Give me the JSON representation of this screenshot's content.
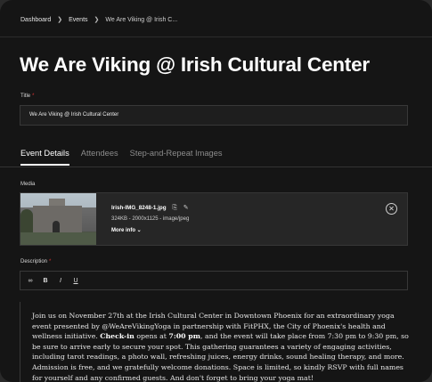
{
  "breadcrumb": {
    "items": [
      "Dashboard",
      "Events"
    ],
    "current": "We Are Viking @ Irish C..."
  },
  "page_title": "We Are Viking @ Irish Cultural Center",
  "title_field": {
    "label": "Title",
    "value": "We Are Viking @ Irish Cultural Center"
  },
  "tabs": [
    {
      "label": "Event Details",
      "active": true
    },
    {
      "label": "Attendees"
    },
    {
      "label": "Step-and-Repeat Images"
    }
  ],
  "media": {
    "label": "Media",
    "filename": "Irish-IMG_8248-1.jpg",
    "meta": "324KB - 2000x1125 - image/jpeg",
    "more_info": "More info",
    "thumbnail_alt": "Irish Cultural Center stone building"
  },
  "description": {
    "label": "Description",
    "toolbar": [
      "link-icon",
      "bold-icon",
      "italic-icon",
      "underline-icon"
    ],
    "text_1": "Join us on November 27th at the Irish Cultural Center in Downtown Phoenix for an extraordinary yoga event presented by @WeAreVikingYoga in partnership with FitPHX, the City of Phoenix's health and wellness initiative.",
    "bold_1": "Check-in",
    "text_2": "opens at",
    "bold_2": "7:00 pm",
    "text_3": ", and the event will take place from 7:30 pm to 9:30 pm, so be sure to arrive early to secure your spot. This gathering guarantees a variety of engaging activities, including tarot readings, a photo wall, refreshing juices, energy drinks, sound healing therapy, and more. Admission is free, and we gratefully welcome donations. Space is limited, so kindly RSVP with full names for yourself and any confirmed guests. And don't forget to bring your yoga mat!"
  }
}
